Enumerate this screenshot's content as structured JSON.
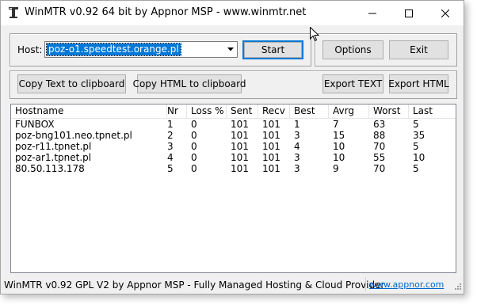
{
  "window": {
    "title": "WinMTR v0.92 64 bit by Appnor MSP - www.winmtr.net"
  },
  "host": {
    "label": "Host:",
    "value": "poz-o1.speedtest.orange.pl"
  },
  "buttons": {
    "start": "Start",
    "options": "Options",
    "exit": "Exit",
    "copy_text": "Copy Text to clipboard",
    "copy_html": "Copy HTML to clipboard",
    "export_text": "Export TEXT",
    "export_html": "Export HTML"
  },
  "table": {
    "columns": [
      "Hostname",
      "Nr",
      "Loss %",
      "Sent",
      "Recv",
      "Best",
      "Avrg",
      "Worst",
      "Last"
    ],
    "rows": [
      [
        "FUNBOX",
        "1",
        "0",
        "101",
        "101",
        "1",
        "7",
        "63",
        "5"
      ],
      [
        "poz-bng101.neo.tpnet.pl",
        "2",
        "0",
        "101",
        "101",
        "3",
        "15",
        "88",
        "35"
      ],
      [
        "poz-r11.tpnet.pl",
        "3",
        "0",
        "101",
        "101",
        "4",
        "10",
        "70",
        "5"
      ],
      [
        "poz-ar1.tpnet.pl",
        "4",
        "0",
        "101",
        "101",
        "3",
        "10",
        "55",
        "10"
      ],
      [
        "80.50.113.178",
        "5",
        "0",
        "101",
        "101",
        "3",
        "9",
        "70",
        "5"
      ]
    ]
  },
  "status": {
    "text": "WinMTR v0.92 GPL V2 by Appnor MSP - Fully Managed Hosting & Cloud Provider",
    "link": "www.appnor.com"
  },
  "icons": {
    "app": "winmtr-app-icon",
    "minimize": "minimize-icon",
    "maximize": "maximize-icon",
    "close": "close-icon",
    "dropdown": "chevron-down-icon",
    "grip": "resize-grip-icon",
    "cursor": "mouse-cursor-icon"
  },
  "colors": {
    "selection": "#0078d7",
    "link": "#0066cc",
    "default_button_border": "#0078d7",
    "window_bg": "#f0f0f0"
  }
}
